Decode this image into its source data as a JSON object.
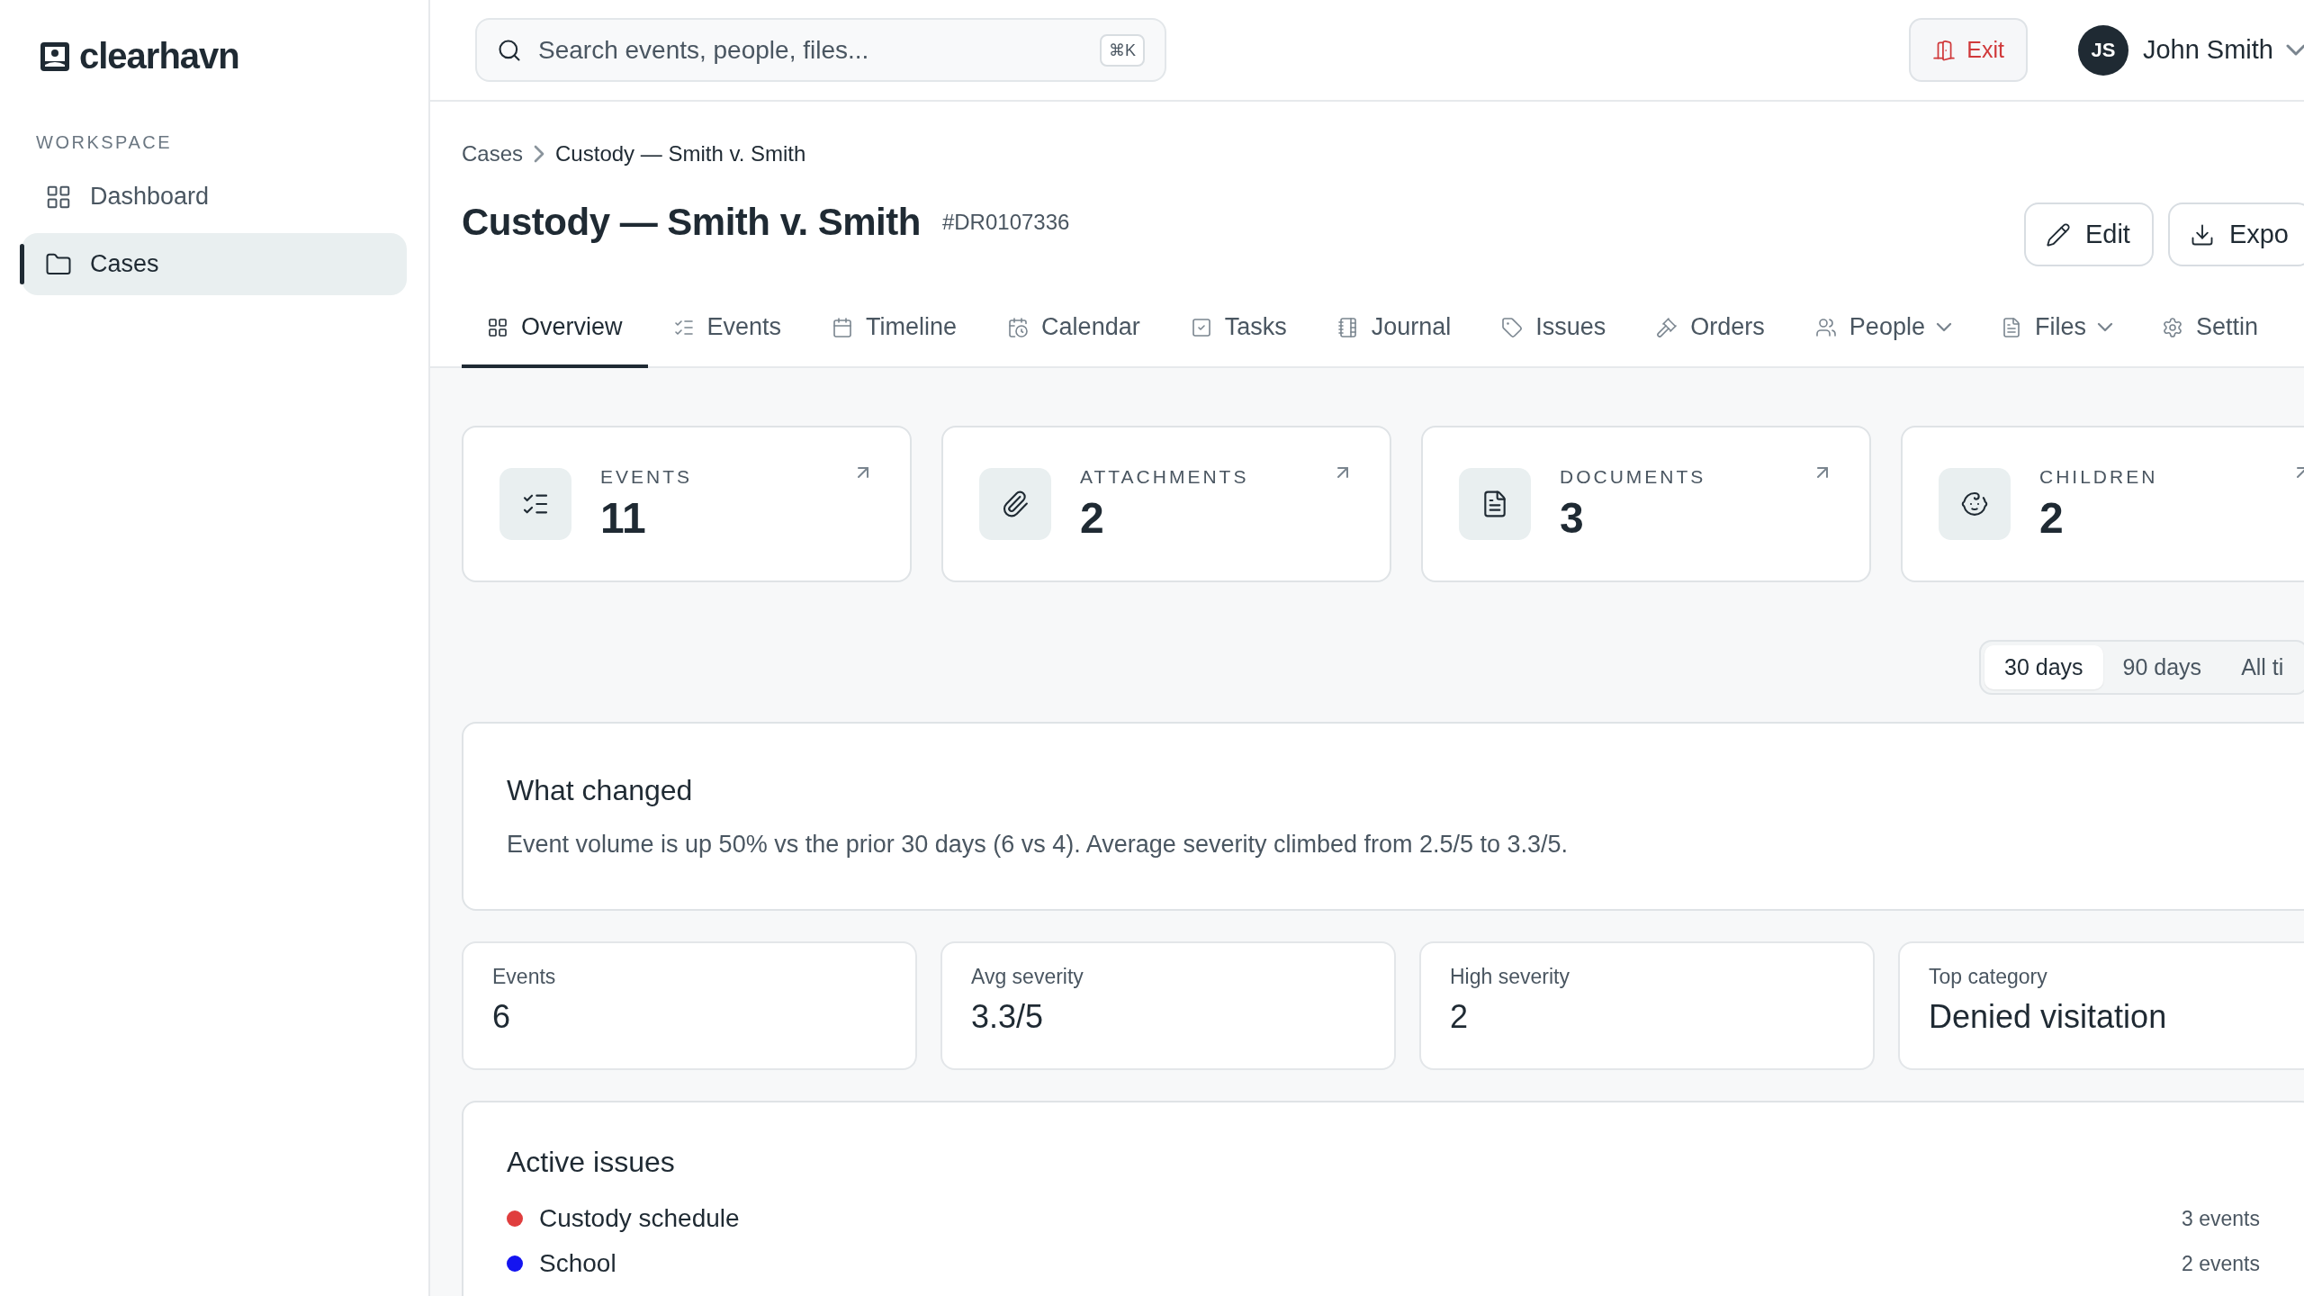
{
  "brand": {
    "name": "clearhavn"
  },
  "sidebar": {
    "section": "WORKSPACE",
    "items": [
      {
        "label": "Dashboard",
        "selected": false
      },
      {
        "label": "Cases",
        "selected": true
      }
    ]
  },
  "header": {
    "search": {
      "placeholder": "Search events, people, files...",
      "shortcut": "⌘K"
    },
    "exit": "Exit",
    "user": {
      "initials": "JS",
      "name": "John Smith"
    }
  },
  "breadcrumb": [
    "Cases",
    "Custody — Smith v. Smith"
  ],
  "case": {
    "title": "Custody — Smith v. Smith",
    "number": "#DR0107336",
    "actions": [
      "Edit",
      "Expo"
    ]
  },
  "tabs": [
    {
      "label": "Overview",
      "selected": true,
      "dropdown": false
    },
    {
      "label": "Events",
      "selected": false,
      "dropdown": false
    },
    {
      "label": "Timeline",
      "selected": false,
      "dropdown": false
    },
    {
      "label": "Calendar",
      "selected": false,
      "dropdown": false
    },
    {
      "label": "Tasks",
      "selected": false,
      "dropdown": false
    },
    {
      "label": "Journal",
      "selected": false,
      "dropdown": false
    },
    {
      "label": "Issues",
      "selected": false,
      "dropdown": false
    },
    {
      "label": "Orders",
      "selected": false,
      "dropdown": false
    },
    {
      "label": "People",
      "selected": false,
      "dropdown": true
    },
    {
      "label": "Files",
      "selected": false,
      "dropdown": true
    },
    {
      "label": "Settin",
      "selected": false,
      "dropdown": false
    }
  ],
  "stats": [
    {
      "label": "EVENTS",
      "value": "11"
    },
    {
      "label": "ATTACHMENTS",
      "value": "2"
    },
    {
      "label": "DOCUMENTS",
      "value": "3"
    },
    {
      "label": "CHILDREN",
      "value": "2"
    }
  ],
  "ranges": [
    {
      "label": "30 days",
      "selected": true
    },
    {
      "label": "90 days",
      "selected": false
    },
    {
      "label": "All ti",
      "selected": false
    }
  ],
  "what_changed": {
    "title": "What changed",
    "text": "Event volume is up 50% vs the prior 30 days (6 vs 4). Average severity climbed from 2.5/5 to 3.3/5."
  },
  "metrics": [
    {
      "label": "Events",
      "value": "6"
    },
    {
      "label": "Avg severity",
      "value": "3.3/5"
    },
    {
      "label": "High severity",
      "value": "2"
    },
    {
      "label": "Top category",
      "value": "Denied visitation"
    }
  ],
  "active_issues": {
    "title": "Active issues",
    "items": [
      {
        "name": "Custody schedule",
        "count": "3 events",
        "color": "#e03e3e"
      },
      {
        "name": "School",
        "count": "2 events",
        "color": "#1414f0"
      }
    ]
  }
}
